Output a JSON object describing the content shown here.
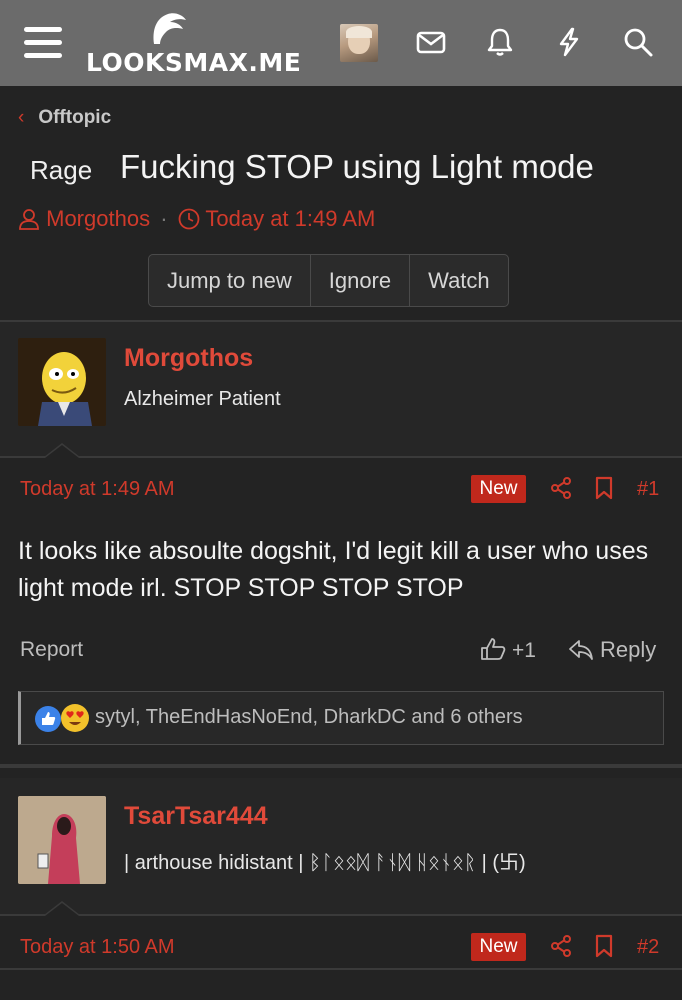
{
  "header": {
    "logo_text": "LOOKSMAX.ME",
    "icons": [
      "menu-icon",
      "envelope-icon",
      "bell-icon",
      "bolt-icon",
      "search-icon"
    ]
  },
  "breadcrumb": {
    "label": "Offtopic"
  },
  "thread": {
    "prefix": "Rage",
    "title": "Fucking STOP using Light mode",
    "author": "Morgothos",
    "time": "Today at 1:49 AM"
  },
  "actions": {
    "jump_to_new": "Jump to new",
    "ignore": "Ignore",
    "watch": "Watch"
  },
  "posts": [
    {
      "username": "Morgothos",
      "user_title": "Alzheimer Patient",
      "date": "Today at 1:49 AM",
      "badge": "New",
      "number": "#1",
      "body": "It looks like absoulte dogshit, I'd legit kill a user who uses light mode irl. STOP STOP STOP STOP",
      "report": "Report",
      "likes": "+1",
      "reply": "Reply",
      "reactions": "sytyl, TheEndHasNoEnd, DharkDC and 6 others"
    },
    {
      "username": "TsarTsar444",
      "user_title": "| arthouse hidistant | ᛒᛚᛟᛟᛞ ᚨᚾᛞ ᚺᛟᚾᛟᚱ | (卐)",
      "date": "Today at 1:50 AM",
      "badge": "New",
      "number": "#2"
    }
  ],
  "colors": {
    "accent": "#d03a2b",
    "header_bg": "#6b6b6b",
    "page_bg": "#232323"
  }
}
